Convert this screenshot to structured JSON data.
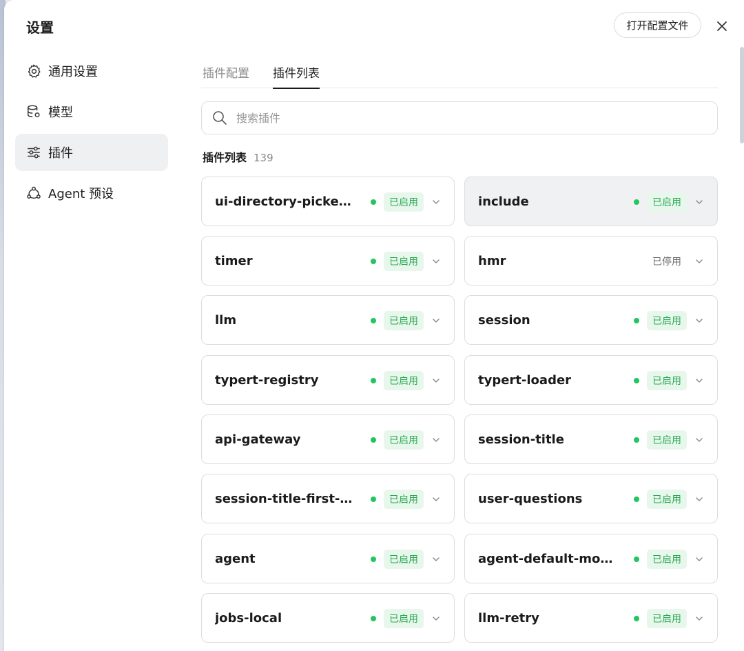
{
  "dialog": {
    "title": "设置",
    "open_config_label": "打开配置文件"
  },
  "sidebar": {
    "items": [
      {
        "label": "通用设置",
        "icon": "gear-icon"
      },
      {
        "label": "模型",
        "icon": "database-icon"
      },
      {
        "label": "插件",
        "icon": "sliders-icon",
        "active": true
      },
      {
        "label": "Agent 预设",
        "icon": "agent-icon"
      }
    ]
  },
  "tabs": [
    {
      "label": "插件配置",
      "active": false
    },
    {
      "label": "插件列表",
      "active": true
    }
  ],
  "search": {
    "placeholder": "搜索插件",
    "value": ""
  },
  "list": {
    "label": "插件列表",
    "count": "139"
  },
  "plugins": [
    {
      "name": "ui-directory-picker-...",
      "status": "已启用",
      "enabled": true
    },
    {
      "name": "include",
      "status": "已启用",
      "enabled": true
    },
    {
      "name": "timer",
      "status": "已启用",
      "enabled": true
    },
    {
      "name": "hmr",
      "status": "已停用",
      "enabled": false
    },
    {
      "name": "llm",
      "status": "已启用",
      "enabled": true
    },
    {
      "name": "session",
      "status": "已启用",
      "enabled": true
    },
    {
      "name": "typert-registry",
      "status": "已启用",
      "enabled": true
    },
    {
      "name": "typert-loader",
      "status": "已启用",
      "enabled": true
    },
    {
      "name": "api-gateway",
      "status": "已启用",
      "enabled": true
    },
    {
      "name": "session-title",
      "status": "已启用",
      "enabled": true
    },
    {
      "name": "session-title-first-pr...",
      "status": "已启用",
      "enabled": true
    },
    {
      "name": "user-questions",
      "status": "已启用",
      "enabled": true
    },
    {
      "name": "agent",
      "status": "已启用",
      "enabled": true
    },
    {
      "name": "agent-default-model",
      "status": "已启用",
      "enabled": true
    },
    {
      "name": "jobs-local",
      "status": "已启用",
      "enabled": true
    },
    {
      "name": "llm-retry",
      "status": "已启用",
      "enabled": true
    }
  ],
  "colors": {
    "enabled_green": "#22c55e",
    "badge_text": "#29a852",
    "badge_bg": "#e8f7ec"
  }
}
